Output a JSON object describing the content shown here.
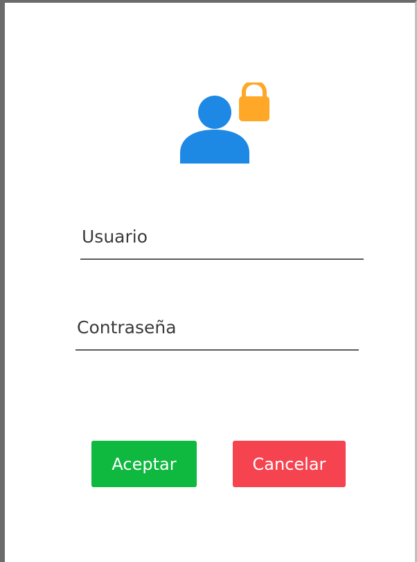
{
  "login_form": {
    "icon": "user-lock-icon",
    "icon_colors": {
      "user": "#1e88e5",
      "lock": "#ffa726"
    },
    "username": {
      "placeholder": "Usuario",
      "value": ""
    },
    "password": {
      "placeholder": "Contraseña",
      "value": ""
    },
    "buttons": {
      "accept_label": "Aceptar",
      "accept_color": "#0fb83f",
      "cancel_label": "Cancelar",
      "cancel_color": "#f5434f"
    }
  }
}
